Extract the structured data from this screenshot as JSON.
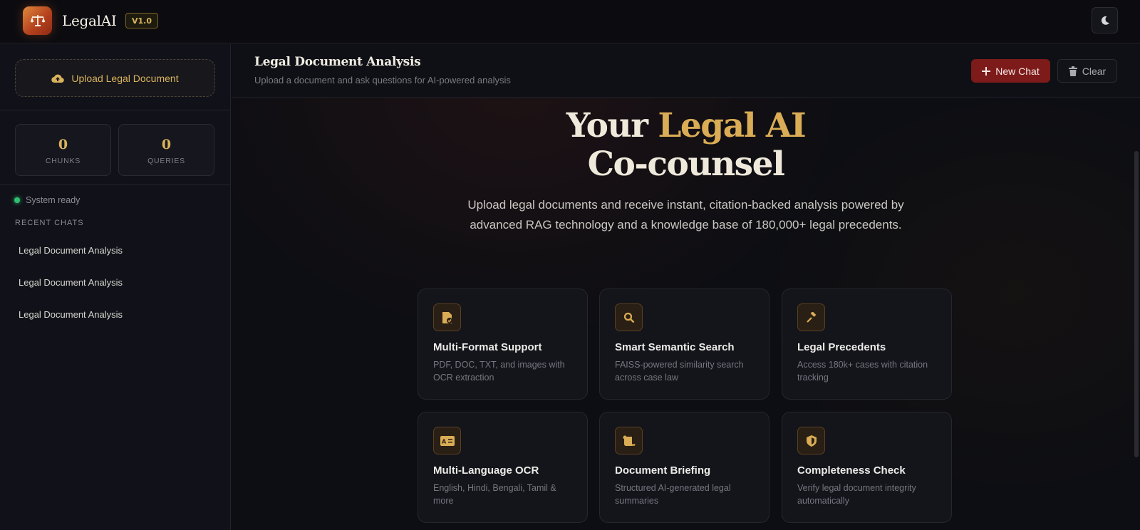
{
  "header": {
    "brand": "LegalAI",
    "version": "V1.0"
  },
  "sidebar": {
    "upload_label": "Upload Legal Document",
    "stats": [
      {
        "value": "0",
        "label": "CHUNKS"
      },
      {
        "value": "0",
        "label": "QUERIES"
      }
    ],
    "status": "System ready",
    "recent_label": "RECENT CHATS",
    "recent_chats": [
      "Legal Document Analysis",
      "Legal Document Analysis",
      "Legal Document Analysis"
    ]
  },
  "main": {
    "title": "Legal Document Analysis",
    "subtitle": "Upload a document and ask questions for AI-powered analysis",
    "new_chat_label": "New Chat",
    "clear_label": "Clear",
    "hero": {
      "line1_prefix": "Your ",
      "line1_highlight": "Legal AI",
      "line2": "Co-counsel",
      "description": "Upload legal documents and receive instant, citation-backed analysis powered by advanced RAG technology and a knowledge base of 180,000+ legal precedents."
    },
    "features": [
      {
        "icon": "file-check-icon",
        "title": "Multi-Format Support",
        "desc": "PDF, DOC, TXT, and images with OCR extraction"
      },
      {
        "icon": "search-icon",
        "title": "Smart Semantic Search",
        "desc": "FAISS-powered similarity search across case law"
      },
      {
        "icon": "gavel-icon",
        "title": "Legal Precedents",
        "desc": "Access 180k+ cases with citation tracking"
      },
      {
        "icon": "language-icon",
        "title": "Multi-Language OCR",
        "desc": "English, Hindi, Bengali, Tamil & more"
      },
      {
        "icon": "scroll-icon",
        "title": "Document Briefing",
        "desc": "Structured AI-generated legal summaries"
      },
      {
        "icon": "shield-icon",
        "title": "Completeness Check",
        "desc": "Verify legal document integrity automatically"
      }
    ]
  },
  "colors": {
    "accent_gold": "#d9ac55",
    "new_chat_red": "#7d1a1a",
    "status_green": "#2fbf71"
  }
}
